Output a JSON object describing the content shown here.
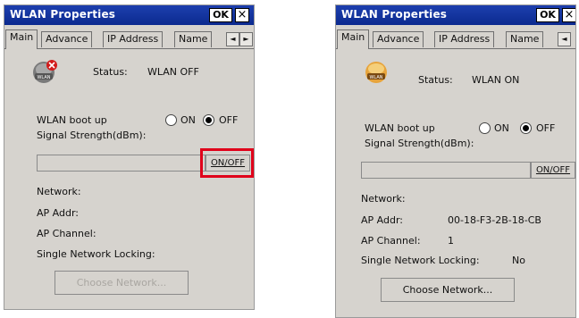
{
  "left": {
    "title": "WLAN Properties",
    "ok": "OK",
    "close": "×",
    "tabs": [
      "Main",
      "Advance",
      "IP Address",
      "Name"
    ],
    "scroll_left": "◄",
    "scroll_right": "►",
    "status_label": "Status:",
    "status_value": "WLAN OFF",
    "boot_label": "WLAN boot up",
    "on_label": "ON",
    "off_label": "OFF",
    "boot_selected": "OFF",
    "signal_label": "Signal Strength(dBm):",
    "onoff_button": "ON/OFF",
    "network_label": "Network:",
    "network_value": "",
    "ap_addr_label": "AP Addr:",
    "ap_addr_value": "",
    "ap_channel_label": "AP Channel:",
    "ap_channel_value": "",
    "locking_label": "Single Network Locking:",
    "locking_value": "",
    "choose_button": "Choose Network...",
    "highlight_color": "#e0001a"
  },
  "right": {
    "title": "WLAN Properties",
    "ok": "OK",
    "close": "×",
    "tabs": [
      "Main",
      "Advance",
      "IP Address",
      "Name"
    ],
    "scroll_left": "◄",
    "status_label": "Status:",
    "status_value": "WLAN ON",
    "boot_label": "WLAN boot up",
    "on_label": "ON",
    "off_label": "OFF",
    "boot_selected": "OFF",
    "signal_label": "Signal Strength(dBm):",
    "onoff_button": "ON/OFF",
    "network_label": "Network:",
    "network_value": "",
    "ap_addr_label": "AP Addr:",
    "ap_addr_value": "00-18-F3-2B-18-CB",
    "ap_channel_label": "AP Channel:",
    "ap_channel_value": "1",
    "locking_label": "Single Network Locking:",
    "locking_value": "No",
    "choose_button": "Choose Network..."
  },
  "colors": {
    "titlebar": "#0b2a8f",
    "dialog_bg": "#d6d3ce"
  },
  "icons": {
    "status_off": "wlan-off-icon",
    "status_on": "wlan-on-icon"
  }
}
